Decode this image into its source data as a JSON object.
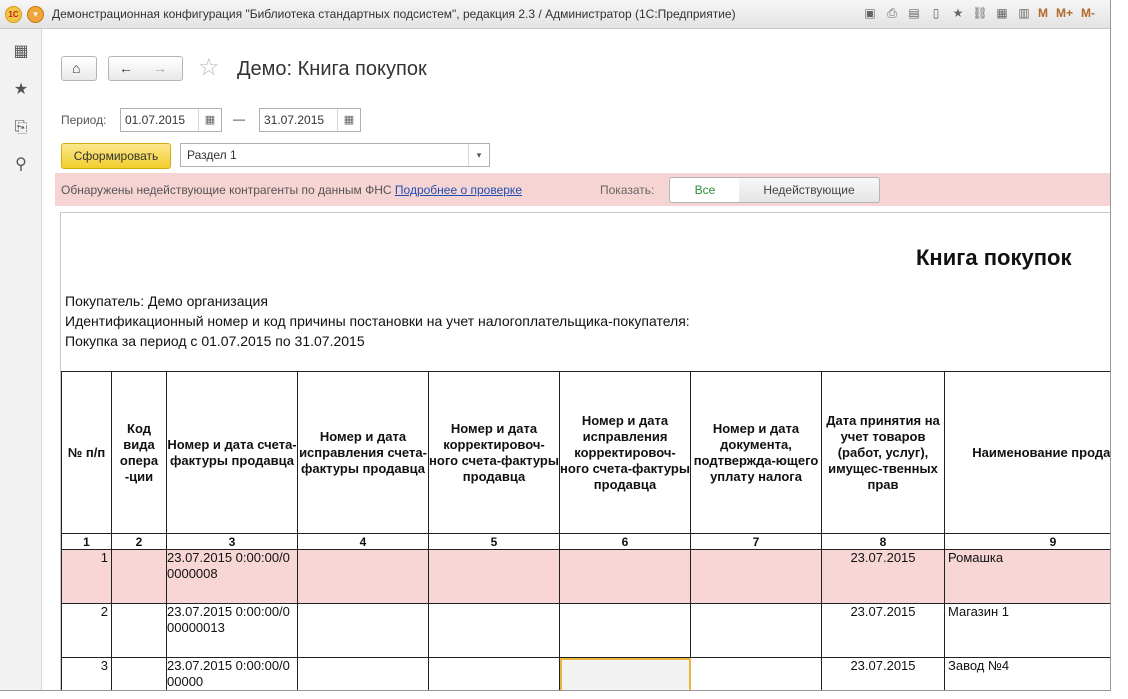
{
  "window": {
    "title": "Демонстрационная конфигурация \"Библиотека стандартных подсистем\", редакция 2.3 / Администратор  (1С:Предприятие)",
    "logo_text": "1С",
    "toolbar_icons": [
      "save-icon",
      "print-icon",
      "print-preview-icon",
      "file-icon",
      "favorite-add-icon",
      "link-icon",
      "calculator-icon",
      "calendar-icon"
    ],
    "memory_buttons": [
      "M",
      "M+",
      "M-"
    ]
  },
  "sidebar": {
    "icons": [
      "apps-grid-icon",
      "favorites-star-icon",
      "history-icon",
      "search-icon"
    ]
  },
  "header": {
    "title": "Демо: Книга покупок",
    "home_glyph": "⌂",
    "back_glyph": "←",
    "forward_glyph": "→",
    "star_glyph": "☆"
  },
  "period": {
    "label": "Период:",
    "from": "01.07.2015",
    "to": "31.07.2015",
    "dash": "—"
  },
  "actions": {
    "generate_label": "Сформировать",
    "section_value": "Раздел 1"
  },
  "warning": {
    "text": "Обнаружены недействующие контрагенты по данным ФНС",
    "link": "Подробнее о проверке",
    "show_label": "Показать:",
    "filter_all": "Все",
    "filter_inactive": "Недействующие"
  },
  "report": {
    "title": "Книга покупок",
    "buyer": "Покупатель:  Демо организация",
    "inn_line": "Идентификационный номер и код причины постановки на учет налогоплательщика-покупателя:",
    "period_line": "Покупка за период с 01.07.2015 по 31.07.2015",
    "columns": [
      "№ п/п",
      "Код вида опера -ции",
      "Номер и дата счета-фактуры продавца",
      "Номер и дата исправления счета-фактуры продавца",
      "Номер и дата корректировоч-ного счета-фактуры продавца",
      "Номер и дата исправления корректировоч-ного счета-фактуры продавца",
      "Номер и дата документа, подтвержда-ющего уплату налога",
      "Дата принятия на учет товаров (работ, услуг), имущес-твенных прав",
      "Наименование продавца"
    ],
    "column_numbers": [
      "1",
      "2",
      "3",
      "4",
      "5",
      "6",
      "7",
      "8",
      "9"
    ],
    "rows": [
      {
        "n": "1",
        "code": "",
        "invoice": "23.07.2015 0:00:00/00000008",
        "c4": "",
        "c5": "",
        "c6": "",
        "c7": "",
        "date": "23.07.2015",
        "seller": "Ромашка"
      },
      {
        "n": "2",
        "code": "",
        "invoice": "23.07.2015 0:00:00/000000013",
        "c4": "",
        "c5": "",
        "c6": "",
        "c7": "",
        "date": "23.07.2015",
        "seller": "Магазин 1"
      },
      {
        "n": "3",
        "code": "",
        "invoice": "23.07.2015 0:00:00/000000",
        "c4": "",
        "c5": "",
        "c6": "",
        "c7": "",
        "date": "23.07.2015",
        "seller": "Завод №4"
      }
    ]
  }
}
